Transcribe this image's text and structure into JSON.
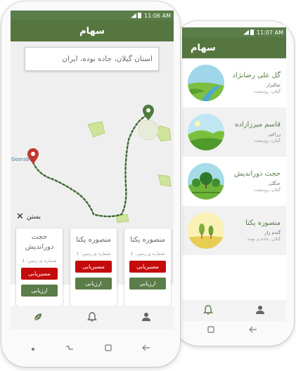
{
  "front": {
    "status_time": "11:06 AM",
    "title": "سهام",
    "search_text": "استان گیلان، جاده نوده، ایران",
    "map_label": "Goorab",
    "close_label": "بستن",
    "cards": [
      {
        "name": "منصوره یکتا",
        "land": "شماره ی زمین: 2",
        "route": "مسیریابی",
        "eval": "ارزیابی"
      },
      {
        "name": "منصوره یکتا",
        "land": "شماره ی زمین: 1",
        "route": "مسیریابی",
        "eval": "ارزیابی"
      },
      {
        "name": "حجت دوراندیش",
        "land": "شماره ی زمین: 1",
        "route": "مسیریابی",
        "eval": "ارزیابی"
      }
    ],
    "nav_icons": [
      "leaf-icon",
      "bell-icon",
      "person-icon"
    ]
  },
  "back": {
    "status_time": "11:07 AM",
    "title": "سهام",
    "items": [
      {
        "name": "گل علی رضانژاد",
        "crop": "شالیزار",
        "location": "گیلان، رودپشت"
      },
      {
        "name": "قاسم میرزازاده",
        "crop": "زراعی",
        "location": "گیلان، رودپشت"
      },
      {
        "name": "حجت دوراندیش",
        "crop": "جنگلی",
        "location": "گیلان، رودپشت"
      },
      {
        "name": "منصوره یکتا",
        "crop": "گندم زار",
        "location": "گیلان، جاده ی نوده"
      }
    ]
  },
  "colors": {
    "primary": "#56763f",
    "route": "#c40c0c",
    "pin": "#c0392b"
  }
}
